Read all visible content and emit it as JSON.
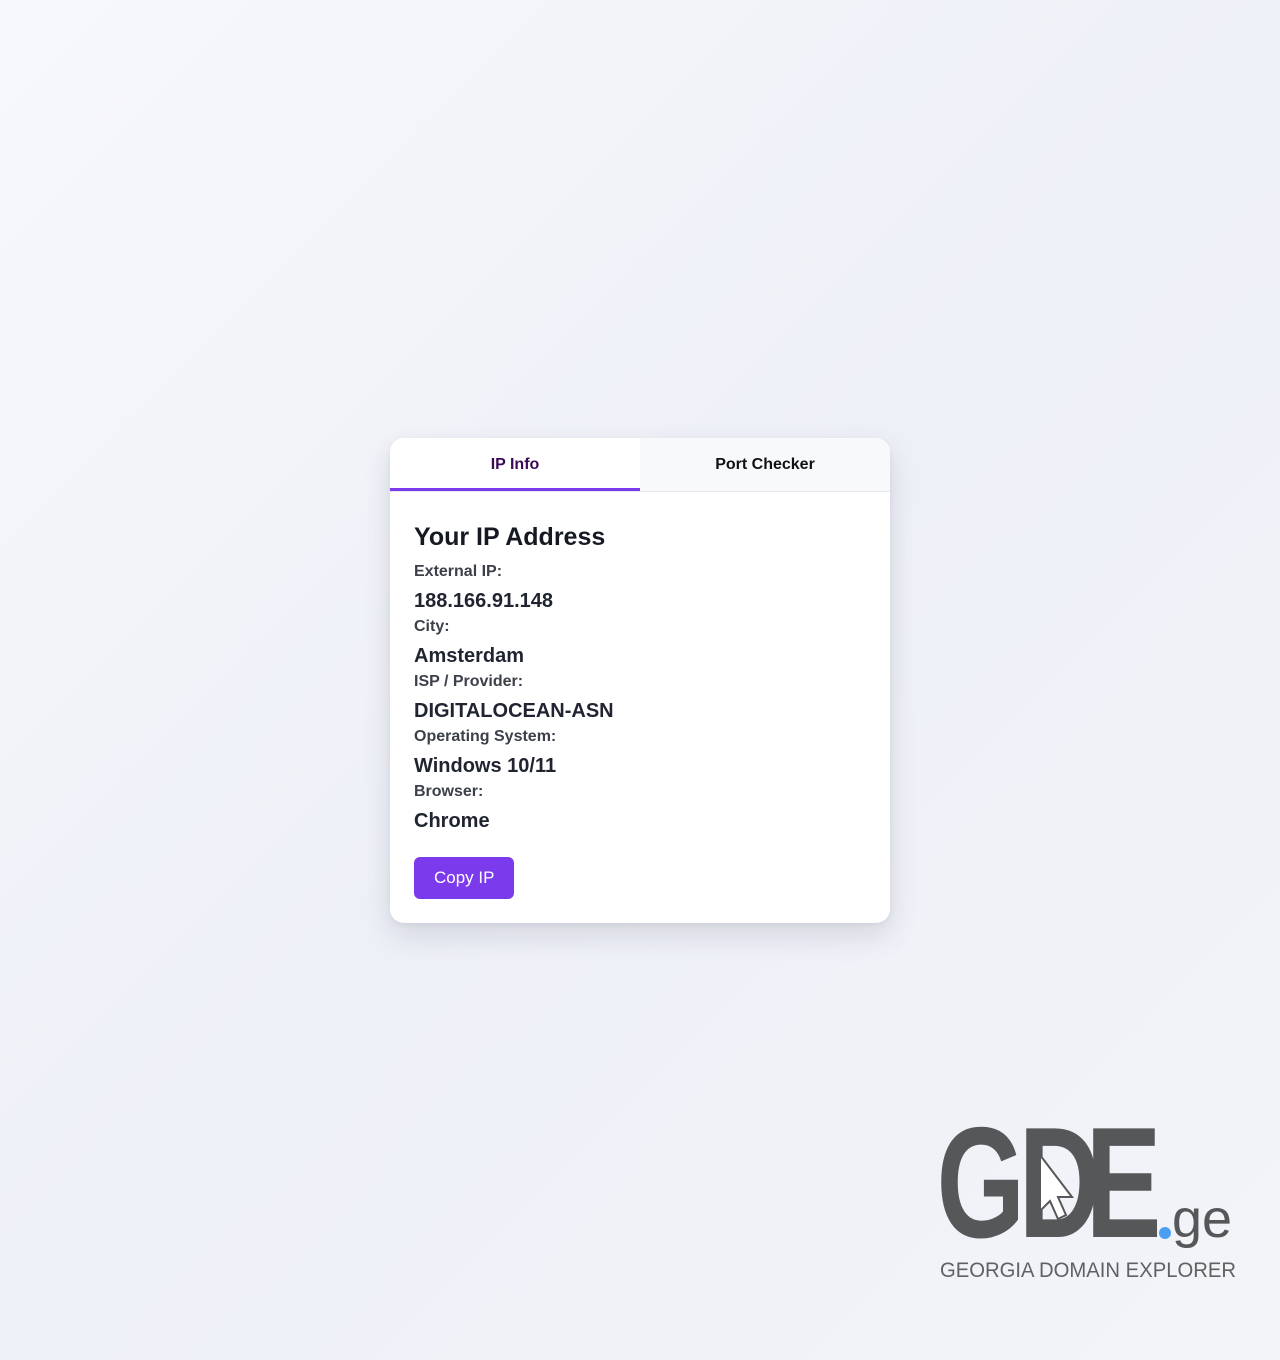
{
  "tabs": [
    {
      "label": "IP Info",
      "active": true
    },
    {
      "label": "Port Checker",
      "active": false
    }
  ],
  "ip_info": {
    "heading": "Your IP Address",
    "fields": [
      {
        "label": "External IP:",
        "value": "188.166.91.148"
      },
      {
        "label": "City:",
        "value": "Amsterdam"
      },
      {
        "label": "ISP / Provider:",
        "value": "DIGITALOCEAN-ASN"
      },
      {
        "label": "Operating System:",
        "value": "Windows 10/11"
      },
      {
        "label": "Browser:",
        "value": "Chrome"
      }
    ],
    "copy_button_label": "Copy IP"
  },
  "logo": {
    "letters_g": "G",
    "letters_d": "D",
    "letters_e": "E",
    "suffix": "ge",
    "tagline": "GEORGIA DOMAIN EXPLORER"
  },
  "colors": {
    "accent": "#7c3aed",
    "active_tab_text": "#3b0a57",
    "logo_gray": "#555759",
    "logo_dot": "#4a9ff5"
  }
}
